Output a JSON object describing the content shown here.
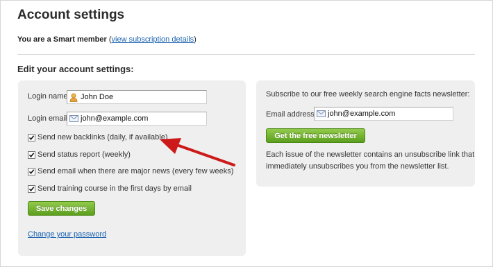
{
  "page_title": "Account settings",
  "membership": {
    "prefix": "You are a Smart member",
    "open_paren": "(",
    "link_label": "view subscription details",
    "close_paren": ")"
  },
  "section_title": "Edit your account settings:",
  "account": {
    "login_name_label": "Login name:",
    "login_name_value": "John Doe",
    "login_email_label": "Login email:",
    "login_email_value": "john@example.com",
    "checkboxes": [
      {
        "label": "Send new backlinks (daily, if available)",
        "checked": true
      },
      {
        "label": "Send status report (weekly)",
        "checked": true
      },
      {
        "label": "Send email when there are major news (every few weeks)",
        "checked": true
      },
      {
        "label": "Send training course in the first days by email",
        "checked": true
      }
    ],
    "save_label": "Save changes",
    "change_password_label": "Change your password"
  },
  "newsletter": {
    "intro": "Subscribe to our free weekly search engine facts newsletter:",
    "email_label": "Email address:",
    "email_value": "john@example.com",
    "button_label": "Get the free newsletter",
    "note_line1": "Each issue of the newsletter contains an unsubscribe link that",
    "note_line2": "immediately unsubscribes you from the newsletter list."
  },
  "colors": {
    "button_green": "#6aa82a",
    "link_blue": "#1a63b0",
    "arrow_red": "#cc1a1a",
    "panel_bg": "#efefef"
  },
  "icons": {
    "login_name": "user-icon",
    "email": "envelope-icon",
    "annotation": "red-arrow-icon"
  }
}
